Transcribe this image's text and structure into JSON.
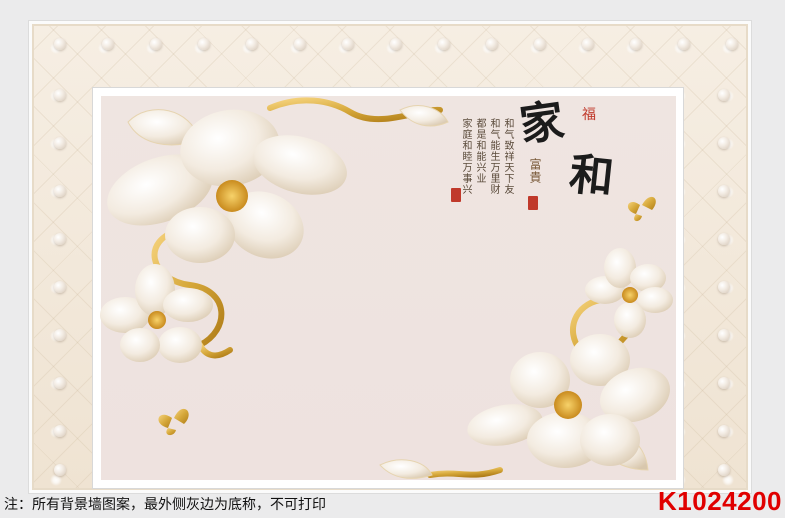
{
  "wall_design": {
    "calligraphy_main": "家和",
    "calligraphy_char_1": "家",
    "calligraphy_char_2": "和",
    "mark_top": "福",
    "subtitle": "富貴",
    "poem_columns": [
      "和气致祥天下友",
      "和气能生万里财",
      "都是和能兴业",
      "家庭和睦万事兴"
    ]
  },
  "footer": {
    "note": "注：所有背景墙图案，最外侧灰边为底称，不可打印",
    "product_code": "K1024200"
  },
  "colors": {
    "border_gray": "#ebebec",
    "leather": "#f6eee3",
    "panel_bg": "#efe5e1",
    "gold": "#d6a83a",
    "code_red": "#e00000"
  }
}
